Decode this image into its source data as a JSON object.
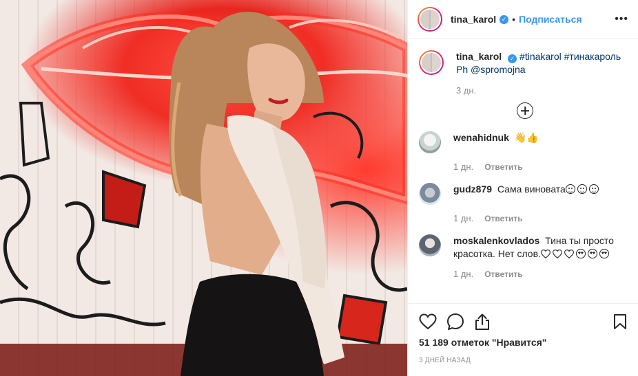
{
  "header": {
    "username": "tina_karol",
    "dot": "•",
    "follow_label": "Подписаться",
    "more_label": "•••"
  },
  "caption": {
    "username": "tina_karol",
    "tags": "#tinakarol #тинакароль",
    "credit": "Ph @spromojna",
    "time": "3 дн."
  },
  "comments": [
    {
      "username": "wenahidnuk",
      "text": "",
      "emoji": [
        "waving-hand",
        "thumbs-up"
      ],
      "time": "1 дн.",
      "reply_label": "Ответить"
    },
    {
      "username": "gudz879",
      "text": "Сама виновата",
      "emoji": [
        "face",
        "face",
        "face"
      ],
      "time": "1 дн.",
      "reply_label": "Ответить"
    },
    {
      "username": "moskalenkovlados",
      "text": "Тина ты просто красотка. Нет слов.",
      "emoji": [
        "heart",
        "heart",
        "heart",
        "heart-eyes",
        "heart-eyes",
        "heart-eyes"
      ],
      "time": "1 дн.",
      "reply_label": "Ответить"
    }
  ],
  "actions": {
    "likes": "51 189 отметок \"Нравится\"",
    "date": "3 дней назад"
  },
  "icons": {
    "like": "heart-icon",
    "comment": "comment-icon",
    "share": "share-icon",
    "save": "bookmark-icon",
    "load_more": "plus-circle-icon"
  }
}
